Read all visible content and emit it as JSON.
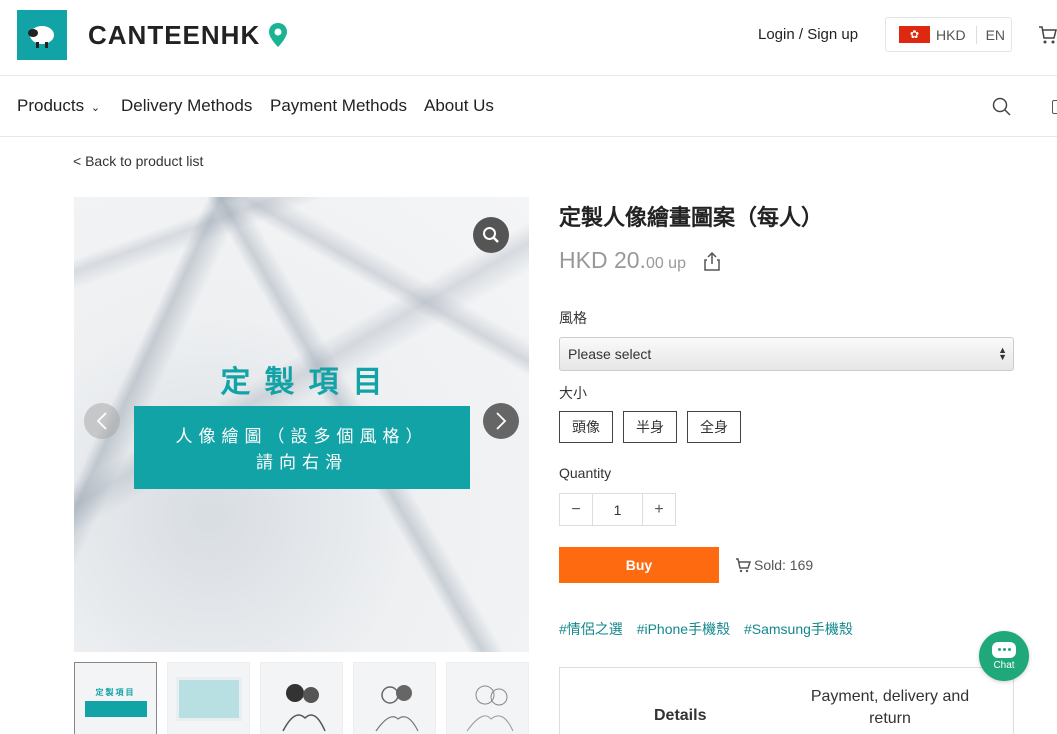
{
  "header": {
    "brand": "CANTEENHK",
    "login_label": "Login / Sign up",
    "currency": "HKD",
    "language": "EN"
  },
  "nav": {
    "items": [
      "Products",
      "Delivery Methods",
      "Payment Methods",
      "About Us"
    ]
  },
  "back_link": "< Back to product list",
  "gallery": {
    "image_title": "定製項目",
    "image_banner_line1": "人像繪圖（設多個風格）",
    "image_banner_line2": "請向右滑",
    "thumb_title": "定製項目"
  },
  "product": {
    "title": "定製人像繪畫圖案（每人）",
    "price_main": "HKD 20.",
    "price_suffix": "00 up",
    "style_label": "風格",
    "style_select": "Please select",
    "size_label": "大小",
    "size_options": [
      "頭像",
      "半身",
      "全身"
    ],
    "quantity_label": "Quantity",
    "quantity_value": "1",
    "buy_label": "Buy",
    "sold_text": "Sold: 169",
    "tags": [
      "#情侶之選",
      "#iPhone手機殼",
      "#Samsung手機殼"
    ]
  },
  "tabs": {
    "details": "Details",
    "payment_line1": "Payment, delivery and",
    "payment_line2": "return"
  },
  "chat": {
    "label": "Chat"
  },
  "colors": {
    "brand": "#12a3a7",
    "buy": "#fe6a10",
    "tag": "#12888d",
    "chat": "#1fa87a"
  }
}
